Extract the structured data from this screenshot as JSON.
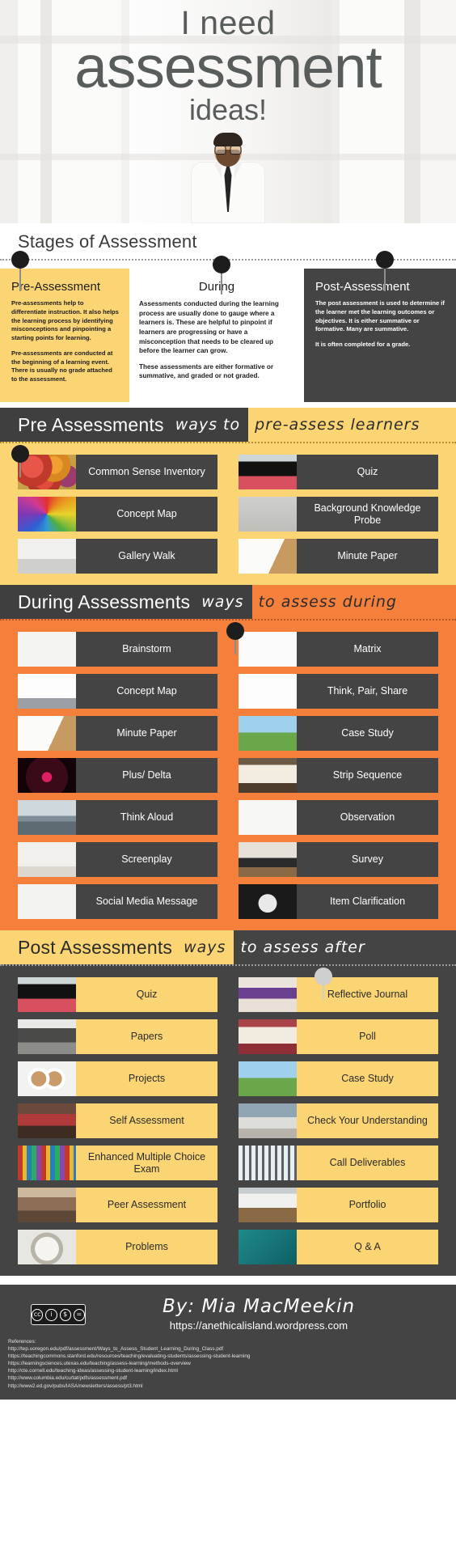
{
  "hero": {
    "line1": "I need",
    "line2": "assessment",
    "line3": "ideas!"
  },
  "stages": {
    "title": "Stages of Assessment",
    "columns": [
      {
        "heading": "Pre-Assessment",
        "paragraphs": [
          "Pre-assessments help to differentiate instruction. It also helps the learning process by identifying misconceptions and pinpointing a starting points for learning.",
          "Pre-assessments are conducted at the beginning of a learning event. There is usually no grade attached to the assessment."
        ]
      },
      {
        "heading": "During",
        "paragraphs": [
          "Assessments conducted during the learning process are usually done to gauge where a learners is. These are helpful to pinpoint if learners are progressing or have a misconception that needs to be cleared up before the learner can grow.",
          "These assessments are either formative or summative, and graded or not graded."
        ]
      },
      {
        "heading": "Post-Assessment",
        "paragraphs": [
          "The post assessment is used to determine if the learner met the learning outcomes or objectives. It is either summative or formative. Many are summative.",
          "It is often completed for a grade."
        ]
      }
    ]
  },
  "sections": [
    {
      "id": "pre",
      "title": "Pre Assessments",
      "script_inside": "ways to",
      "script_outside": "pre-assess learners",
      "items": [
        {
          "label": "Common Sense Inventory",
          "icon": "apples-photo"
        },
        {
          "label": "Quiz",
          "icon": "laptop-photo"
        },
        {
          "label": "Concept Map",
          "icon": "colored-pencils-photo"
        },
        {
          "label": "Background Knowledge Probe",
          "icon": "payphones-photo"
        },
        {
          "label": "Gallery Walk",
          "icon": "gallery-photo"
        },
        {
          "label": "Minute Paper",
          "icon": "pen-paper-photo"
        }
      ]
    },
    {
      "id": "during",
      "title": "During Assessments",
      "script_inside": "ways",
      "script_outside": "to assess during",
      "items": [
        {
          "label": "Brainstorm",
          "icon": "question-mark-photo"
        },
        {
          "label": "Matrix",
          "icon": "blank-white-photo"
        },
        {
          "label": "Concept Map",
          "icon": "mindmap-photo"
        },
        {
          "label": "Think, Pair, Share",
          "icon": "lightbulb-sketch"
        },
        {
          "label": "Minute Paper",
          "icon": "pen-paper-photo"
        },
        {
          "label": "Case Study",
          "icon": "tree-photo"
        },
        {
          "label": "Plus/ Delta",
          "icon": "speedometer-photo"
        },
        {
          "label": "Strip Sequence",
          "icon": "open-book-photo"
        },
        {
          "label": "Think Aloud",
          "icon": "person-lake-photo"
        },
        {
          "label": "Observation",
          "icon": "map-sketch-photo"
        },
        {
          "label": "Screenplay",
          "icon": "palm-trees-photo"
        },
        {
          "label": "Survey",
          "icon": "laptop-desk-photo"
        },
        {
          "label": "Social Media Message",
          "icon": "network-people-photo"
        },
        {
          "label": "Item Clarification",
          "icon": "robot-photo"
        }
      ]
    },
    {
      "id": "post",
      "title": "Post Assessments",
      "script_inside": "ways",
      "script_outside": "to assess after",
      "items": [
        {
          "label": "Quiz",
          "icon": "laptop-photo"
        },
        {
          "label": "Reflective Journal",
          "icon": "desk-journal-photo"
        },
        {
          "label": "Papers",
          "icon": "pen-desk-photo"
        },
        {
          "label": "Poll",
          "icon": "book-phone-photo"
        },
        {
          "label": "Projects",
          "icon": "coffee-cups-photo"
        },
        {
          "label": "Case Study",
          "icon": "tree-photo"
        },
        {
          "label": "Self Assessment",
          "icon": "study-group-photo"
        },
        {
          "label": "Check Your Understanding",
          "icon": "bench-photo"
        },
        {
          "label": "Enhanced Multiple Choice Exam",
          "icon": "bookshelf-photo"
        },
        {
          "label": "Call Deliverables",
          "icon": "snow-forest-photo"
        },
        {
          "label": "Peer Assessment",
          "icon": "students-photo"
        },
        {
          "label": "Portfolio",
          "icon": "laptop-table-photo"
        },
        {
          "label": "Problems",
          "icon": "alarm-clock-photo"
        },
        {
          "label": "Q & A",
          "icon": "teal-abstract-photo"
        }
      ]
    }
  ],
  "footer": {
    "byline": "By:  Mia  MacMeekin",
    "site": "https://anethicalisland.wordpress.com",
    "license_badge": "creative-commons-by-nc-nd",
    "references_heading": "References:",
    "references": [
      "http://tep.uoregon.edu/pdf/assessment/Ways_to_Assess_Student_Learning_During_Class.pdf",
      "https://teachingcommons.stanford.edu/resources/teaching/evaluating-students/assessing-student-learning",
      "https://learningsciences.utexas.edu/teaching/assess-learning/methods-overview",
      "http://cte.cornell.edu/teaching-ideas/assessing-student-learning/index.html",
      "http://www.columbia.edu/cu/tat/pdfs/assessment.pdf",
      "http://www2.ed.gov/pubs/IASA/newsletters/assess/pt3.html"
    ]
  },
  "colors": {
    "yellow": "#fbd474",
    "orange": "#f4803c",
    "dark": "#444444",
    "darker": "#3f3f3f",
    "text_dark": "#2b2b2b"
  }
}
